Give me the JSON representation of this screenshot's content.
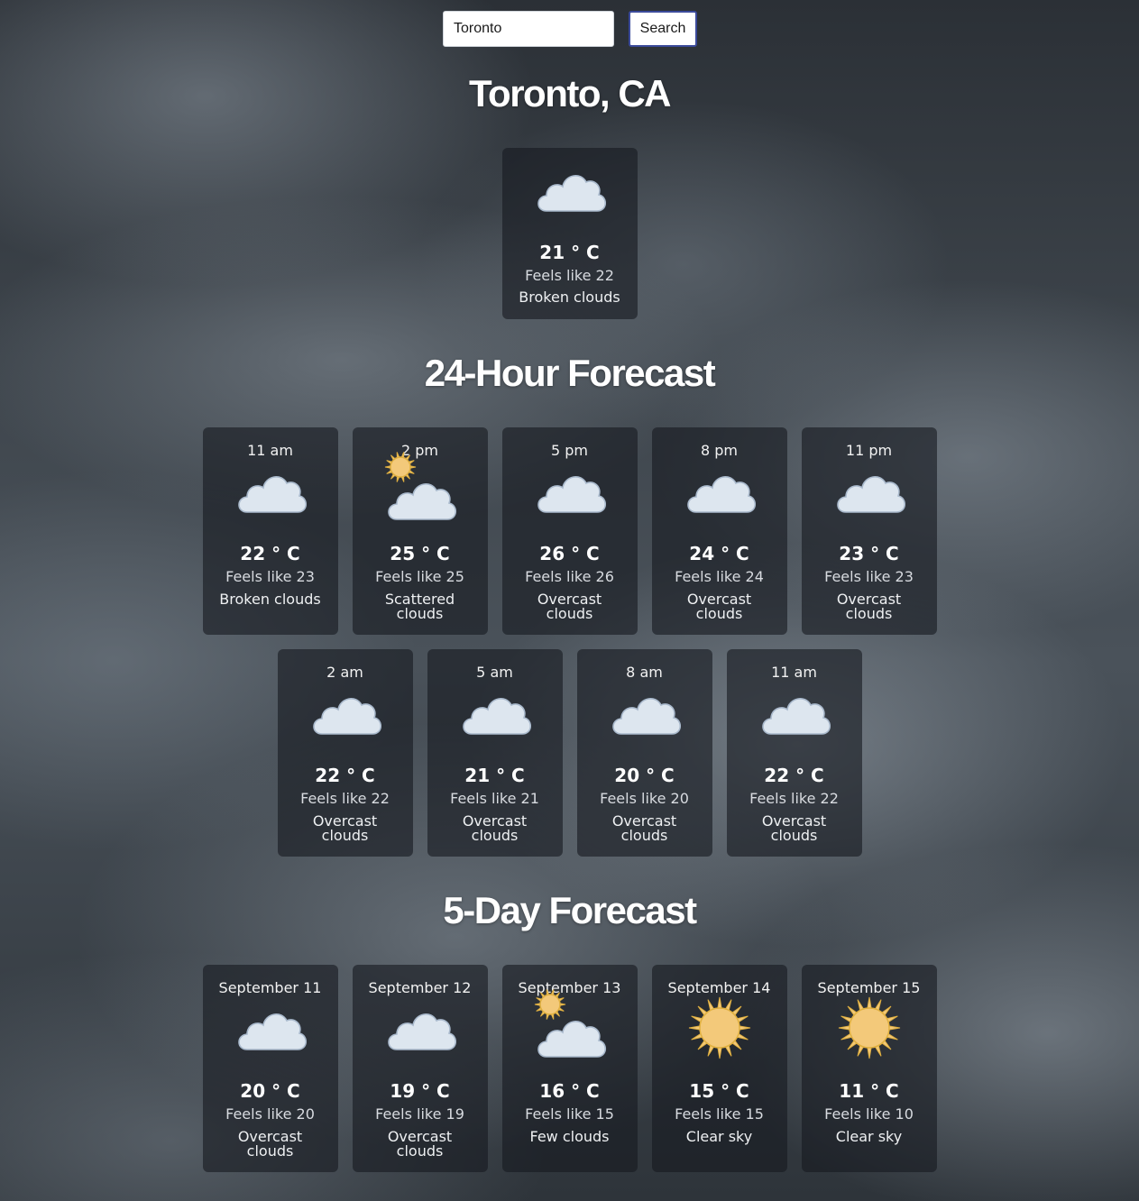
{
  "search": {
    "value": "Toronto",
    "button_label": "Search"
  },
  "location": "Toronto, CA",
  "current": {
    "icon": "cloud-icon",
    "temp": "21 ° C",
    "feels": "Feels like 22",
    "desc": "Broken clouds"
  },
  "hourly_title": "24-Hour Forecast",
  "hourly": [
    {
      "time": "11 am",
      "icon": "cloud-icon",
      "temp": "22 ° C",
      "feels": "Feels like 23",
      "desc": "Broken clouds"
    },
    {
      "time": "2 pm",
      "icon": "sun-cloud-icon",
      "temp": "25 ° C",
      "feels": "Feels like 25",
      "desc": "Scattered clouds"
    },
    {
      "time": "5 pm",
      "icon": "cloud-icon",
      "temp": "26 ° C",
      "feels": "Feels like 26",
      "desc": "Overcast clouds"
    },
    {
      "time": "8 pm",
      "icon": "cloud-icon",
      "temp": "24 ° C",
      "feels": "Feels like 24",
      "desc": "Overcast clouds"
    },
    {
      "time": "11 pm",
      "icon": "cloud-icon",
      "temp": "23 ° C",
      "feels": "Feels like 23",
      "desc": "Overcast clouds"
    },
    {
      "time": "2 am",
      "icon": "cloud-icon",
      "temp": "22 ° C",
      "feels": "Feels like 22",
      "desc": "Overcast clouds"
    },
    {
      "time": "5 am",
      "icon": "cloud-icon",
      "temp": "21 ° C",
      "feels": "Feels like 21",
      "desc": "Overcast clouds"
    },
    {
      "time": "8 am",
      "icon": "cloud-icon",
      "temp": "20 ° C",
      "feels": "Feels like 20",
      "desc": "Overcast clouds"
    },
    {
      "time": "11 am",
      "icon": "cloud-icon",
      "temp": "22 ° C",
      "feels": "Feels like 22",
      "desc": "Overcast clouds"
    }
  ],
  "daily_title": "5-Day Forecast",
  "daily": [
    {
      "date": "September 11",
      "icon": "cloud-icon",
      "temp": "20 ° C",
      "feels": "Feels like 20",
      "desc": "Overcast clouds"
    },
    {
      "date": "September 12",
      "icon": "cloud-icon",
      "temp": "19 ° C",
      "feels": "Feels like 19",
      "desc": "Overcast clouds"
    },
    {
      "date": "September 13",
      "icon": "sun-cloud-icon",
      "temp": "16 ° C",
      "feels": "Feels like 15",
      "desc": "Few clouds"
    },
    {
      "date": "September 14",
      "icon": "sun-icon",
      "temp": "15 ° C",
      "feels": "Feels like 15",
      "desc": "Clear sky"
    },
    {
      "date": "September 15",
      "icon": "sun-icon",
      "temp": "11 ° C",
      "feels": "Feels like 10",
      "desc": "Clear sky"
    }
  ],
  "colors": {
    "card_bg": "#161a20",
    "cloud": "#dde6ef",
    "cloud_stroke": "#a9b9cc",
    "sun": "#f3c97a",
    "sun_stroke": "#e0b040",
    "button_border": "#3b4a9a"
  }
}
